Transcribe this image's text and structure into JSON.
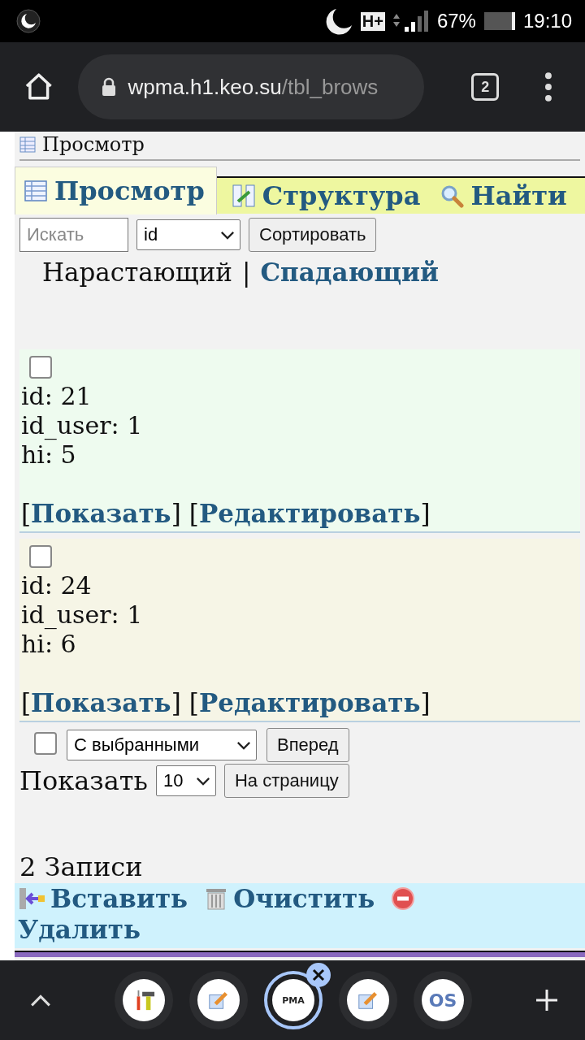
{
  "status_bar": {
    "network": "H+",
    "battery": "67%",
    "time": "19:10"
  },
  "browser": {
    "url_host": "wpma.h1.keo.su",
    "url_path": "/tbl_brows",
    "tab_count": "2"
  },
  "page": {
    "heading": "Просмотр",
    "tabs": [
      {
        "kind": "browse",
        "label": "Просмотр",
        "selected": true
      },
      {
        "kind": "structure",
        "label": "Структура",
        "selected": false
      },
      {
        "kind": "search",
        "label": "Найти",
        "selected": false
      }
    ],
    "search": {
      "placeholder": "Искать",
      "sort_field": "id",
      "sort_button": "Сортировать"
    },
    "order": {
      "separator": "|",
      "items": [
        {
          "label": "Нарастающий",
          "selected": true
        },
        {
          "label": "Спадающий",
          "selected": false
        }
      ]
    },
    "records": [
      {
        "checked": false,
        "lines": [
          "id: 21",
          "id_user: 1",
          "hi: 5"
        ],
        "links": [
          {
            "before": "[",
            "label": "Показать",
            "after": "]"
          },
          {
            "before": "[",
            "label": "Редактировать",
            "after": "]"
          }
        ]
      },
      {
        "checked": false,
        "lines": [
          "id: 24",
          "id_user: 1",
          "hi: 6"
        ],
        "links": [
          {
            "before": "[",
            "label": "Показать",
            "after": "]"
          },
          {
            "before": "[",
            "label": "Редактировать",
            "after": "]"
          }
        ]
      }
    ],
    "bulk": {
      "checked": false,
      "action": "С выбранными",
      "button": "Вперед"
    },
    "paging": {
      "label": "Показать",
      "per_page": "10",
      "button": "На страницу"
    },
    "count": "2 Записи",
    "actions": [
      {
        "kind": "insert",
        "label": "Вставить"
      },
      {
        "kind": "empty",
        "label": "Очистить"
      },
      {
        "kind": "delete",
        "label": "Удалить"
      }
    ]
  },
  "tab_strip": [
    {
      "kind": "tools",
      "selected": false
    },
    {
      "kind": "edit",
      "selected": false
    },
    {
      "kind": "pma",
      "text": "PMA",
      "selected": true
    },
    {
      "kind": "edit",
      "selected": false
    },
    {
      "kind": "os",
      "text": "OS",
      "selected": false
    }
  ]
}
